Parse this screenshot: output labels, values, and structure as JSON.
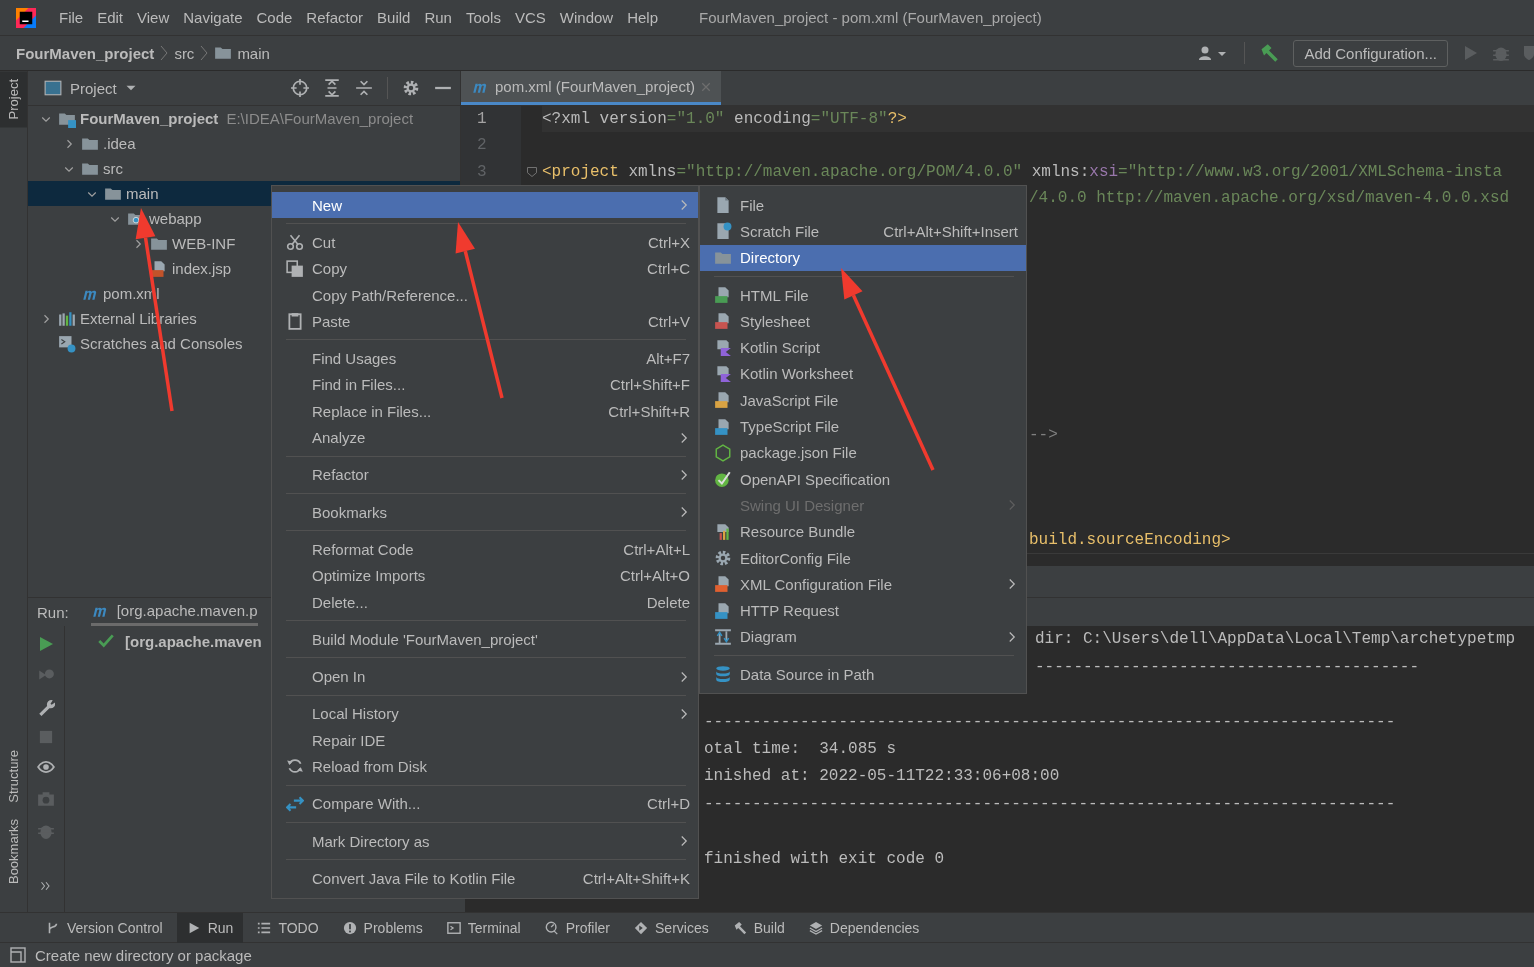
{
  "menu_bar": {
    "items": [
      "File",
      "Edit",
      "View",
      "Navigate",
      "Code",
      "Refactor",
      "Build",
      "Run",
      "Tools",
      "VCS",
      "Window",
      "Help"
    ],
    "title": "FourMaven_project - pom.xml (FourMaven_project)"
  },
  "nav_bar": {
    "breadcrumbs": [
      "FourMaven_project",
      "src",
      "main"
    ],
    "config_button": "Add Configuration..."
  },
  "left_strip": {
    "top": [
      {
        "label": "Project",
        "selected": true
      }
    ],
    "bottom": [
      {
        "label": "Structure",
        "selected": false
      },
      {
        "label": "Bookmarks",
        "selected": false
      }
    ]
  },
  "project_panel": {
    "title": "Project",
    "tree": [
      {
        "label": "FourMaven_project",
        "detail": "E:\\IDEA\\FourMaven_project",
        "kind": "project",
        "expanded": true,
        "selected": false,
        "children": [
          {
            "label": ".idea",
            "kind": "folder",
            "expanded": false,
            "selected": false
          },
          {
            "label": "src",
            "kind": "folder",
            "expanded": true,
            "selected": false,
            "children": [
              {
                "label": "main",
                "kind": "folder",
                "expanded": true,
                "selected": true,
                "children": [
                  {
                    "label": "webapp",
                    "kind": "webfolder",
                    "expanded": true,
                    "selected": false,
                    "children": [
                      {
                        "label": "WEB-INF",
                        "kind": "folder",
                        "expanded": false,
                        "selected": false
                      },
                      {
                        "label": "index.jsp",
                        "kind": "jsp",
                        "selected": false
                      }
                    ]
                  }
                ]
              }
            ]
          },
          {
            "label": "pom.xml",
            "kind": "maven",
            "selected": false
          }
        ]
      },
      {
        "label": "External Libraries",
        "kind": "libraries",
        "expanded": false,
        "selected": false
      },
      {
        "label": "Scratches and Consoles",
        "kind": "scratches",
        "selected": false
      }
    ]
  },
  "editor": {
    "tabs": [
      {
        "label": "pom.xml (FourMaven_project)",
        "selected": true
      }
    ],
    "lines": [
      {
        "number": "1",
        "current": true,
        "fold": false,
        "tokens": [
          {
            "text": "<?xml version",
            "kind": "attr"
          },
          {
            "text": "=\"1.0\"",
            "kind": "value"
          },
          {
            "text": " encoding",
            "kind": "attr"
          },
          {
            "text": "=\"UTF-8\"",
            "kind": "value"
          },
          {
            "text": "?>",
            "kind": "tag"
          }
        ]
      },
      {
        "number": "2",
        "current": false,
        "fold": false
      },
      {
        "number": "3",
        "current": false,
        "fold": true,
        "tokens": [
          {
            "text": "<project",
            "kind": "tag"
          },
          {
            "text": " xmlns",
            "kind": "attr"
          },
          {
            "text": "=\"http://maven.apache.org/POM/4.0.0\"",
            "kind": "value"
          },
          {
            "text": " xmlns:",
            "kind": "attr"
          },
          {
            "text": "xsi",
            "kind": "ns"
          },
          {
            "text": "=\"http://www.w3.org/2001/XMLSchema-insta",
            "kind": "value"
          }
        ]
      }
    ],
    "partly_hidden_lines": [
      {
        "tokens": [
          {
            "text": "/4.0.0 http://maven.apache.org/xsd/maven-4.0.0.xsd",
            "kind": "value"
          }
        ]
      },
      {
        "tokens": [
          {
            "text": "-->",
            "kind": "comment"
          }
        ]
      },
      {
        "tokens": [
          {
            "text": "build.sourceEncoding>",
            "kind": "tag"
          }
        ]
      }
    ]
  },
  "run_panel": {
    "label": "Run:",
    "tabs": [
      {
        "label": "[org.apache.maven.p",
        "selected": true
      }
    ],
    "tree": [
      {
        "label": "[org.apache.maven",
        "kind": "success"
      }
    ],
    "console": [
      {
        "text": "dir: C:\\Users\\dell\\AppData\\Local\\Temp\\archetypetmp",
        "kind": "behind-submenu"
      },
      {
        "text": "----------------------------------------",
        "kind": "behind-submenu"
      },
      {
        "text": "------------------------------------------------------------------------",
        "kind": "behind-menu"
      },
      {
        "text": "otal time:  34.085 s",
        "kind": "behind-menu"
      },
      {
        "text": "inished at: 2022-05-11T22:33:06+08:00",
        "kind": "behind-menu"
      },
      {
        "text": "------------------------------------------------------------------------",
        "kind": "behind-menu"
      },
      {
        "text": "finished with exit code 0",
        "kind": "behind-menu"
      }
    ]
  },
  "context_menu": {
    "groups": [
      [
        {
          "label": "New",
          "kind": "plain",
          "submenu": true,
          "selected": true
        }
      ],
      [
        {
          "label": "Cut",
          "kind": "cut",
          "shortcut": "Ctrl+X",
          "submenu": false,
          "selected": false
        },
        {
          "label": "Copy",
          "kind": "copy",
          "shortcut": "Ctrl+C",
          "submenu": false,
          "selected": false
        },
        {
          "label": "Copy Path/Reference...",
          "kind": "plain",
          "submenu": false,
          "selected": false
        },
        {
          "label": "Paste",
          "kind": "paste",
          "shortcut": "Ctrl+V",
          "submenu": false,
          "selected": false
        }
      ],
      [
        {
          "label": "Find Usages",
          "kind": "plain",
          "shortcut": "Alt+F7",
          "submenu": false,
          "selected": false
        },
        {
          "label": "Find in Files...",
          "kind": "plain",
          "shortcut": "Ctrl+Shift+F",
          "submenu": false,
          "selected": false
        },
        {
          "label": "Replace in Files...",
          "kind": "plain",
          "shortcut": "Ctrl+Shift+R",
          "submenu": false,
          "selected": false
        },
        {
          "label": "Analyze",
          "kind": "plain",
          "submenu": true,
          "selected": false
        }
      ],
      [
        {
          "label": "Refactor",
          "kind": "plain",
          "submenu": true,
          "selected": false
        }
      ],
      [
        {
          "label": "Bookmarks",
          "kind": "plain",
          "submenu": true,
          "selected": false
        }
      ],
      [
        {
          "label": "Reformat Code",
          "kind": "plain",
          "shortcut": "Ctrl+Alt+L",
          "submenu": false,
          "selected": false
        },
        {
          "label": "Optimize Imports",
          "kind": "plain",
          "shortcut": "Ctrl+Alt+O",
          "submenu": false,
          "selected": false
        },
        {
          "label": "Delete...",
          "kind": "plain",
          "shortcut": "Delete",
          "submenu": false,
          "selected": false
        }
      ],
      [
        {
          "label": "Build Module 'FourMaven_project'",
          "kind": "plain",
          "submenu": false,
          "selected": false
        }
      ],
      [
        {
          "label": "Open In",
          "kind": "plain",
          "submenu": true,
          "selected": false
        }
      ],
      [
        {
          "label": "Local History",
          "kind": "plain",
          "submenu": true,
          "selected": false
        },
        {
          "label": "Repair IDE",
          "kind": "plain",
          "submenu": false,
          "selected": false
        },
        {
          "label": "Reload from Disk",
          "kind": "reload",
          "submenu": false,
          "selected": false
        }
      ],
      [
        {
          "label": "Compare With...",
          "kind": "compare",
          "shortcut": "Ctrl+D",
          "submenu": false,
          "selected": false
        }
      ],
      [
        {
          "label": "Mark Directory as",
          "kind": "plain",
          "submenu": true,
          "selected": false
        }
      ],
      [
        {
          "label": "Convert Java File to Kotlin File",
          "kind": "plain",
          "shortcut": "Ctrl+Alt+Shift+K",
          "submenu": false,
          "selected": false
        }
      ]
    ]
  },
  "submenu": {
    "groups": [
      [
        {
          "label": "File",
          "kind": "file",
          "submenu": false,
          "disabled": false,
          "selected": false
        },
        {
          "label": "Scratch File",
          "kind": "scratch",
          "shortcut": "Ctrl+Alt+Shift+Insert",
          "submenu": false,
          "disabled": false,
          "selected": false
        },
        {
          "label": "Directory",
          "kind": "directory",
          "submenu": false,
          "disabled": false,
          "selected": true
        }
      ],
      [
        {
          "label": "HTML File",
          "kind": "html",
          "submenu": false,
          "disabled": false,
          "selected": false
        },
        {
          "label": "Stylesheet",
          "kind": "css",
          "submenu": false,
          "disabled": false,
          "selected": false
        },
        {
          "label": "Kotlin Script",
          "kind": "kotlin",
          "submenu": false,
          "disabled": false,
          "selected": false
        },
        {
          "label": "Kotlin Worksheet",
          "kind": "kotlin",
          "submenu": false,
          "disabled": false,
          "selected": false
        },
        {
          "label": "JavaScript File",
          "kind": "js",
          "submenu": false,
          "disabled": false,
          "selected": false
        },
        {
          "label": "TypeScript File",
          "kind": "ts",
          "submenu": false,
          "disabled": false,
          "selected": false
        },
        {
          "label": "package.json File",
          "kind": "npm",
          "submenu": false,
          "disabled": false,
          "selected": false
        },
        {
          "label": "OpenAPI Specification",
          "kind": "openapi",
          "submenu": false,
          "disabled": false,
          "selected": false
        },
        {
          "label": "Swing UI Designer",
          "kind": "plain",
          "submenu": true,
          "disabled": true,
          "selected": false
        },
        {
          "label": "Resource Bundle",
          "kind": "bundle",
          "submenu": false,
          "disabled": false,
          "selected": false
        },
        {
          "label": "EditorConfig File",
          "kind": "gear",
          "submenu": false,
          "disabled": false,
          "selected": false
        },
        {
          "label": "XML Configuration File",
          "kind": "xml",
          "submenu": true,
          "disabled": false,
          "selected": false
        },
        {
          "label": "HTTP Request",
          "kind": "http",
          "submenu": false,
          "disabled": false,
          "selected": false
        },
        {
          "label": "Diagram",
          "kind": "diagram",
          "submenu": true,
          "disabled": false,
          "selected": false
        }
      ],
      [
        {
          "label": "Data Source in Path",
          "kind": "database",
          "submenu": false,
          "disabled": false,
          "selected": false
        }
      ]
    ]
  },
  "tool_strip": {
    "items": [
      {
        "label": "Version Control",
        "kind": "vcs",
        "selected": false
      },
      {
        "label": "Run",
        "kind": "run",
        "selected": true
      },
      {
        "label": "TODO",
        "kind": "todo",
        "selected": false
      },
      {
        "label": "Problems",
        "kind": "problems",
        "selected": false
      },
      {
        "label": "Terminal",
        "kind": "terminal",
        "selected": false
      },
      {
        "label": "Profiler",
        "kind": "profiler",
        "selected": false
      },
      {
        "label": "Services",
        "kind": "services",
        "selected": false
      },
      {
        "label": "Build",
        "kind": "build",
        "selected": false
      },
      {
        "label": "Dependencies",
        "kind": "dependencies",
        "selected": false
      }
    ]
  },
  "status_bar": {
    "message": "Create new directory or package"
  }
}
